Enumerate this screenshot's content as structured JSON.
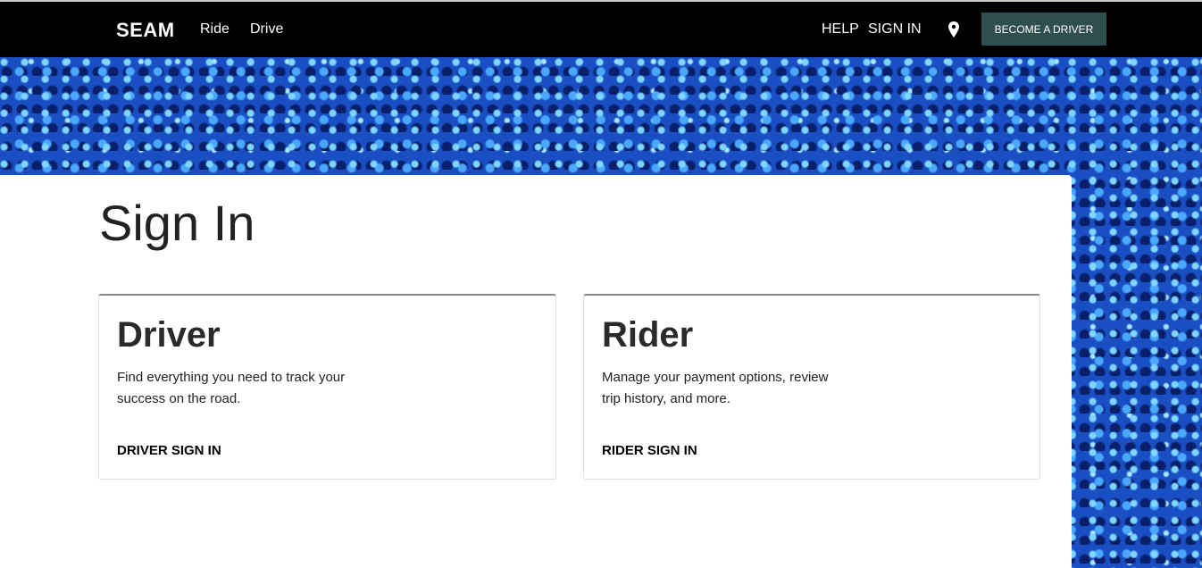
{
  "nav": {
    "logo": "SEAM",
    "ride": "Ride",
    "drive": "Drive",
    "help": "HELP",
    "sign_in": "SIGN IN",
    "become_driver": "BECOME A DRIVER"
  },
  "page_title": "Sign In",
  "cards": [
    {
      "title": "Driver",
      "description": "Find everything you need to track your success on the road.",
      "link": "DRIVER SIGN IN"
    },
    {
      "title": "Rider",
      "description": "Manage your payment options, review trip history, and more.",
      "link": "RIDER SIGN IN"
    }
  ]
}
